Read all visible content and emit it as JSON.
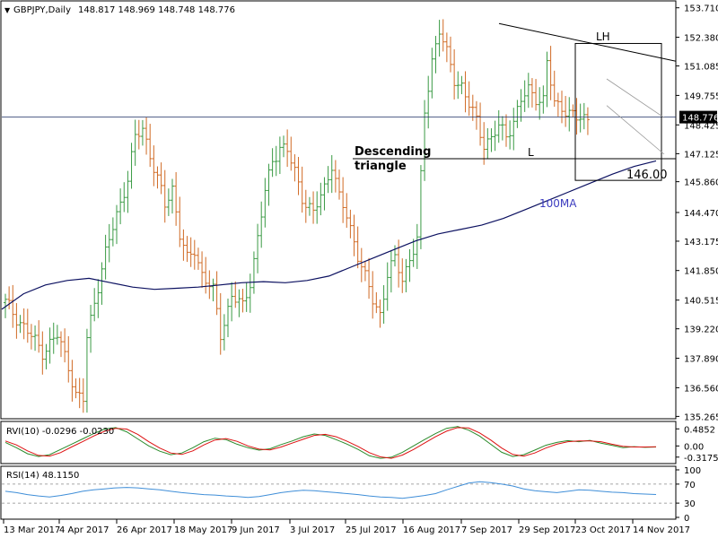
{
  "colors": {
    "bull": "#3a9a44",
    "bear": "#d06a24",
    "ma": "#0b1060",
    "rvi_main": "#2a8a2a",
    "rvi_signal": "#dd1111",
    "rsi": "#3f8ed8",
    "grid_level": "#1c2f63",
    "annotation_text": "#3b3bbf"
  },
  "chart_data": [
    {
      "type": "candlestick",
      "title": "GBPJPY,Daily",
      "ohlc_readout": "148.817 148.969 148.748 148.776",
      "symbol_icon": "triangle-down-icon",
      "ylim": [
        135.2,
        153.9
      ],
      "y_ticks": [
        "153.710",
        "152.380",
        "151.085",
        "149.755",
        "148.425",
        "147.125",
        "145.860",
        "144.470",
        "143.175",
        "141.850",
        "140.515",
        "139.220",
        "137.890",
        "136.560",
        "135.265"
      ],
      "last_price": "148.776",
      "x_ticks": [
        "13 Mar 2017",
        "4 Apr 2017",
        "26 Apr 2017",
        "18 May 2017",
        "9 Jun 2017",
        "3 Jul 2017",
        "25 Jul 2017",
        "16 Aug 2017",
        "7 Sep 2017",
        "29 Sep 2017",
        "23 Oct 2017",
        "14 Nov 2017"
      ],
      "close_path": [
        [
          0,
          140.4
        ],
        [
          5,
          139.3
        ],
        [
          10,
          138.2
        ],
        [
          14,
          138.9
        ],
        [
          17,
          137.6
        ],
        [
          19,
          136.2
        ],
        [
          21,
          136.0
        ],
        [
          22,
          138.8
        ],
        [
          24,
          140.5
        ],
        [
          27,
          142.6
        ],
        [
          30,
          144.4
        ],
        [
          33,
          146.0
        ],
        [
          35,
          147.8
        ],
        [
          37,
          148.3
        ],
        [
          40,
          146.5
        ],
        [
          43,
          144.8
        ],
        [
          45,
          145.6
        ],
        [
          47,
          143.5
        ],
        [
          49,
          142.3
        ],
        [
          51,
          142.8
        ],
        [
          53,
          141.7
        ],
        [
          56,
          140.9
        ],
        [
          58,
          139.0
        ],
        [
          61,
          140.7
        ],
        [
          64,
          140.2
        ],
        [
          66,
          141.4
        ],
        [
          68,
          143.3
        ],
        [
          70,
          145.4
        ],
        [
          72,
          146.8
        ],
        [
          74,
          147.5
        ],
        [
          76,
          147.2
        ],
        [
          78,
          146.3
        ],
        [
          80,
          145.2
        ],
        [
          83,
          144.4
        ],
        [
          86,
          145.6
        ],
        [
          88,
          146.7
        ],
        [
          90,
          145.1
        ],
        [
          92,
          144.3
        ],
        [
          94,
          143.2
        ],
        [
          95,
          142.6
        ],
        [
          97,
          141.5
        ],
        [
          99,
          140.5
        ],
        [
          101,
          139.9
        ],
        [
          103,
          141.7
        ],
        [
          105,
          142.3
        ],
        [
          107,
          141.5
        ],
        [
          109,
          142.4
        ],
        [
          111,
          143.2
        ],
        [
          112,
          146.0
        ],
        [
          113,
          149.0
        ],
        [
          115,
          151.4
        ],
        [
          117,
          152.7
        ],
        [
          119,
          151.6
        ],
        [
          121,
          150.5
        ],
        [
          123,
          150.2
        ],
        [
          125,
          149.3
        ],
        [
          127,
          148.6
        ],
        [
          129,
          147.6
        ],
        [
          131,
          147.8
        ],
        [
          133,
          148.3
        ],
        [
          135,
          148.0
        ],
        [
          137,
          148.6
        ],
        [
          139,
          149.5
        ],
        [
          141,
          150.0
        ],
        [
          143,
          149.7
        ],
        [
          145,
          149.5
        ],
        [
          146,
          151.2
        ],
        [
          148,
          149.4
        ],
        [
          150,
          149.3
        ],
        [
          152,
          148.9
        ],
        [
          154,
          148.7
        ],
        [
          157,
          148.78
        ]
      ],
      "ma_label": "100MA",
      "ma_values": [
        140.1,
        140.8,
        141.2,
        141.4,
        141.5,
        141.3,
        141.1,
        141.0,
        141.05,
        141.1,
        141.2,
        141.3,
        141.35,
        141.3,
        141.4,
        141.6,
        142.0,
        142.4,
        142.8,
        143.2,
        143.5,
        143.7,
        143.9,
        144.2,
        144.6,
        145.0,
        145.4,
        145.8,
        146.2,
        146.55,
        146.8
      ],
      "annotations": [
        {
          "text": "Descending",
          "role": "pattern-title"
        },
        {
          "text": "triangle",
          "role": "pattern-title"
        },
        {
          "text": "LH",
          "role": "lower-high"
        },
        {
          "text": "L",
          "role": "low"
        },
        {
          "text": "146.00",
          "role": "target"
        },
        {
          "text": "100MA",
          "role": "ma-label"
        }
      ],
      "horizontal_level": 146.9,
      "target_level": 146.0
    },
    {
      "type": "line",
      "title": "RVI(10) -0.0296 -0.0230",
      "ylim": [
        -0.45,
        0.62
      ],
      "y_ticks": [
        "0.4852",
        "0.00",
        "-0.3175"
      ],
      "series": [
        {
          "name": "main",
          "values": [
            0.1,
            -0.05,
            -0.22,
            -0.3,
            -0.25,
            -0.1,
            0.05,
            0.2,
            0.35,
            0.48,
            0.52,
            0.4,
            0.2,
            0.0,
            -0.15,
            -0.25,
            -0.2,
            -0.05,
            0.12,
            0.22,
            0.18,
            0.05,
            -0.05,
            -0.12,
            -0.08,
            0.04,
            0.14,
            0.26,
            0.34,
            0.3,
            0.18,
            0.05,
            -0.1,
            -0.28,
            -0.35,
            -0.32,
            -0.18,
            0.0,
            0.18,
            0.35,
            0.5,
            0.55,
            0.45,
            0.28,
            0.05,
            -0.18,
            -0.3,
            -0.25,
            -0.12,
            0.02,
            0.1,
            0.15,
            0.12,
            0.16,
            0.08,
            0.02,
            -0.05,
            -0.02,
            -0.04,
            -0.03
          ]
        },
        {
          "name": "signal",
          "values": [
            0.14,
            0.03,
            -0.14,
            -0.27,
            -0.29,
            -0.19,
            -0.03,
            0.12,
            0.28,
            0.42,
            0.5,
            0.48,
            0.33,
            0.12,
            -0.06,
            -0.2,
            -0.24,
            -0.14,
            0.03,
            0.17,
            0.21,
            0.13,
            0.0,
            -0.09,
            -0.11,
            -0.03,
            0.08,
            0.19,
            0.3,
            0.33,
            0.26,
            0.13,
            -0.02,
            -0.19,
            -0.31,
            -0.35,
            -0.26,
            -0.1,
            0.08,
            0.26,
            0.42,
            0.52,
            0.51,
            0.37,
            0.17,
            -0.06,
            -0.24,
            -0.29,
            -0.2,
            -0.06,
            0.05,
            0.12,
            0.14,
            0.14,
            0.12,
            0.05,
            -0.01,
            -0.03,
            -0.03,
            -0.023
          ]
        }
      ]
    },
    {
      "type": "line",
      "title": "RSI(14) 48.1150",
      "ylim": [
        0,
        100
      ],
      "y_ticks": [
        "100",
        "70",
        "30",
        "0"
      ],
      "levels": [
        70,
        30
      ],
      "series": [
        {
          "name": "RSI",
          "values": [
            55,
            52,
            48,
            45,
            43,
            46,
            50,
            55,
            58,
            60,
            62,
            63,
            62,
            60,
            58,
            55,
            52,
            50,
            48,
            47,
            45,
            44,
            42,
            44,
            48,
            52,
            55,
            57,
            56,
            54,
            52,
            50,
            48,
            45,
            43,
            42,
            40,
            43,
            46,
            50,
            58,
            65,
            72,
            75,
            73,
            70,
            66,
            60,
            56,
            54,
            52,
            55,
            58,
            57,
            55,
            53,
            52,
            50,
            49,
            48.1
          ]
        }
      ]
    }
  ]
}
